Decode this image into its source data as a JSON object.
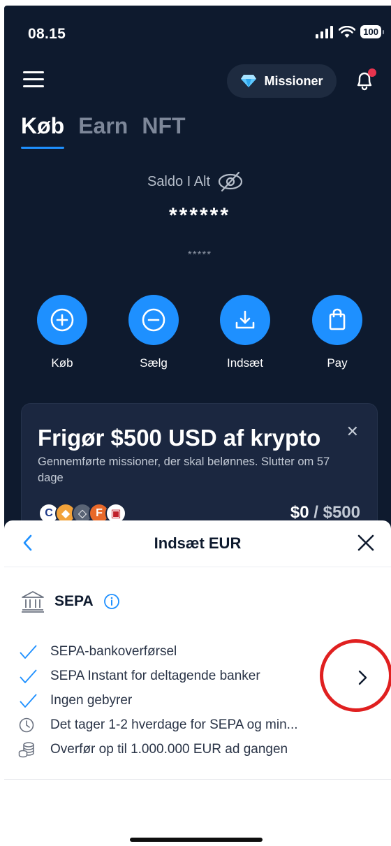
{
  "status": {
    "time": "08.15",
    "battery": "100"
  },
  "header": {
    "missions_label": "Missioner"
  },
  "tabs": [
    {
      "label": "Køb",
      "active": true
    },
    {
      "label": "Earn",
      "active": false
    },
    {
      "label": "NFT",
      "active": false
    }
  ],
  "balance": {
    "label": "Saldo I Alt",
    "value": "******",
    "sub_value": "*****"
  },
  "actions": [
    {
      "label": "Køb",
      "icon": "plus-circle-icon"
    },
    {
      "label": "Sælg",
      "icon": "minus-circle-icon"
    },
    {
      "label": "Indsæt",
      "icon": "download-icon"
    },
    {
      "label": "Pay",
      "icon": "shopping-bag-icon"
    }
  ],
  "promo": {
    "title": "Frigør $500 USD af krypto",
    "text": "Gennemførte missioner, der skal belønnes. Slutter om 57 dage",
    "progress_current": "$0",
    "progress_separator": " / ",
    "progress_total": "$500"
  },
  "sheet": {
    "title": "Indsæt EUR",
    "method_name": "SEPA",
    "features": [
      {
        "icon": "check-icon",
        "text": "SEPA-bankoverførsel"
      },
      {
        "icon": "check-icon",
        "text": "SEPA Instant for deltagende banker"
      },
      {
        "icon": "check-icon",
        "text": "Ingen gebyrer"
      },
      {
        "icon": "clock-icon",
        "text": "Det tager 1-2 hverdage for SEPA og min..."
      },
      {
        "icon": "coins-icon",
        "text": "Overfør op til 1.000.000 EUR ad gangen"
      }
    ]
  },
  "colors": {
    "accent": "#1e90ff",
    "dark_bg": "#0e1a2e",
    "card_bg": "#1b2740",
    "annotation_ring": "#e02020"
  }
}
